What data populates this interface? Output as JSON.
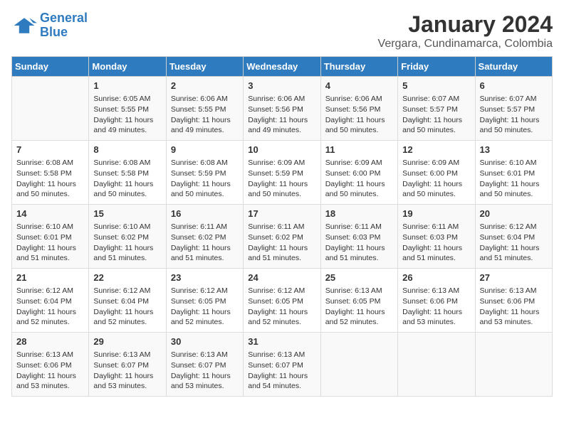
{
  "logo": {
    "line1": "General",
    "line2": "Blue"
  },
  "title": "January 2024",
  "subtitle": "Vergara, Cundinamarca, Colombia",
  "weekdays": [
    "Sunday",
    "Monday",
    "Tuesday",
    "Wednesday",
    "Thursday",
    "Friday",
    "Saturday"
  ],
  "weeks": [
    [
      {
        "day": "",
        "info": ""
      },
      {
        "day": "1",
        "info": "Sunrise: 6:05 AM\nSunset: 5:55 PM\nDaylight: 11 hours\nand 49 minutes."
      },
      {
        "day": "2",
        "info": "Sunrise: 6:06 AM\nSunset: 5:55 PM\nDaylight: 11 hours\nand 49 minutes."
      },
      {
        "day": "3",
        "info": "Sunrise: 6:06 AM\nSunset: 5:56 PM\nDaylight: 11 hours\nand 49 minutes."
      },
      {
        "day": "4",
        "info": "Sunrise: 6:06 AM\nSunset: 5:56 PM\nDaylight: 11 hours\nand 50 minutes."
      },
      {
        "day": "5",
        "info": "Sunrise: 6:07 AM\nSunset: 5:57 PM\nDaylight: 11 hours\nand 50 minutes."
      },
      {
        "day": "6",
        "info": "Sunrise: 6:07 AM\nSunset: 5:57 PM\nDaylight: 11 hours\nand 50 minutes."
      }
    ],
    [
      {
        "day": "7",
        "info": "Sunrise: 6:08 AM\nSunset: 5:58 PM\nDaylight: 11 hours\nand 50 minutes."
      },
      {
        "day": "8",
        "info": "Sunrise: 6:08 AM\nSunset: 5:58 PM\nDaylight: 11 hours\nand 50 minutes."
      },
      {
        "day": "9",
        "info": "Sunrise: 6:08 AM\nSunset: 5:59 PM\nDaylight: 11 hours\nand 50 minutes."
      },
      {
        "day": "10",
        "info": "Sunrise: 6:09 AM\nSunset: 5:59 PM\nDaylight: 11 hours\nand 50 minutes."
      },
      {
        "day": "11",
        "info": "Sunrise: 6:09 AM\nSunset: 6:00 PM\nDaylight: 11 hours\nand 50 minutes."
      },
      {
        "day": "12",
        "info": "Sunrise: 6:09 AM\nSunset: 6:00 PM\nDaylight: 11 hours\nand 50 minutes."
      },
      {
        "day": "13",
        "info": "Sunrise: 6:10 AM\nSunset: 6:01 PM\nDaylight: 11 hours\nand 50 minutes."
      }
    ],
    [
      {
        "day": "14",
        "info": "Sunrise: 6:10 AM\nSunset: 6:01 PM\nDaylight: 11 hours\nand 51 minutes."
      },
      {
        "day": "15",
        "info": "Sunrise: 6:10 AM\nSunset: 6:02 PM\nDaylight: 11 hours\nand 51 minutes."
      },
      {
        "day": "16",
        "info": "Sunrise: 6:11 AM\nSunset: 6:02 PM\nDaylight: 11 hours\nand 51 minutes."
      },
      {
        "day": "17",
        "info": "Sunrise: 6:11 AM\nSunset: 6:02 PM\nDaylight: 11 hours\nand 51 minutes."
      },
      {
        "day": "18",
        "info": "Sunrise: 6:11 AM\nSunset: 6:03 PM\nDaylight: 11 hours\nand 51 minutes."
      },
      {
        "day": "19",
        "info": "Sunrise: 6:11 AM\nSunset: 6:03 PM\nDaylight: 11 hours\nand 51 minutes."
      },
      {
        "day": "20",
        "info": "Sunrise: 6:12 AM\nSunset: 6:04 PM\nDaylight: 11 hours\nand 51 minutes."
      }
    ],
    [
      {
        "day": "21",
        "info": "Sunrise: 6:12 AM\nSunset: 6:04 PM\nDaylight: 11 hours\nand 52 minutes."
      },
      {
        "day": "22",
        "info": "Sunrise: 6:12 AM\nSunset: 6:04 PM\nDaylight: 11 hours\nand 52 minutes."
      },
      {
        "day": "23",
        "info": "Sunrise: 6:12 AM\nSunset: 6:05 PM\nDaylight: 11 hours\nand 52 minutes."
      },
      {
        "day": "24",
        "info": "Sunrise: 6:12 AM\nSunset: 6:05 PM\nDaylight: 11 hours\nand 52 minutes."
      },
      {
        "day": "25",
        "info": "Sunrise: 6:13 AM\nSunset: 6:05 PM\nDaylight: 11 hours\nand 52 minutes."
      },
      {
        "day": "26",
        "info": "Sunrise: 6:13 AM\nSunset: 6:06 PM\nDaylight: 11 hours\nand 53 minutes."
      },
      {
        "day": "27",
        "info": "Sunrise: 6:13 AM\nSunset: 6:06 PM\nDaylight: 11 hours\nand 53 minutes."
      }
    ],
    [
      {
        "day": "28",
        "info": "Sunrise: 6:13 AM\nSunset: 6:06 PM\nDaylight: 11 hours\nand 53 minutes."
      },
      {
        "day": "29",
        "info": "Sunrise: 6:13 AM\nSunset: 6:07 PM\nDaylight: 11 hours\nand 53 minutes."
      },
      {
        "day": "30",
        "info": "Sunrise: 6:13 AM\nSunset: 6:07 PM\nDaylight: 11 hours\nand 53 minutes."
      },
      {
        "day": "31",
        "info": "Sunrise: 6:13 AM\nSunset: 6:07 PM\nDaylight: 11 hours\nand 54 minutes."
      },
      {
        "day": "",
        "info": ""
      },
      {
        "day": "",
        "info": ""
      },
      {
        "day": "",
        "info": ""
      }
    ]
  ]
}
